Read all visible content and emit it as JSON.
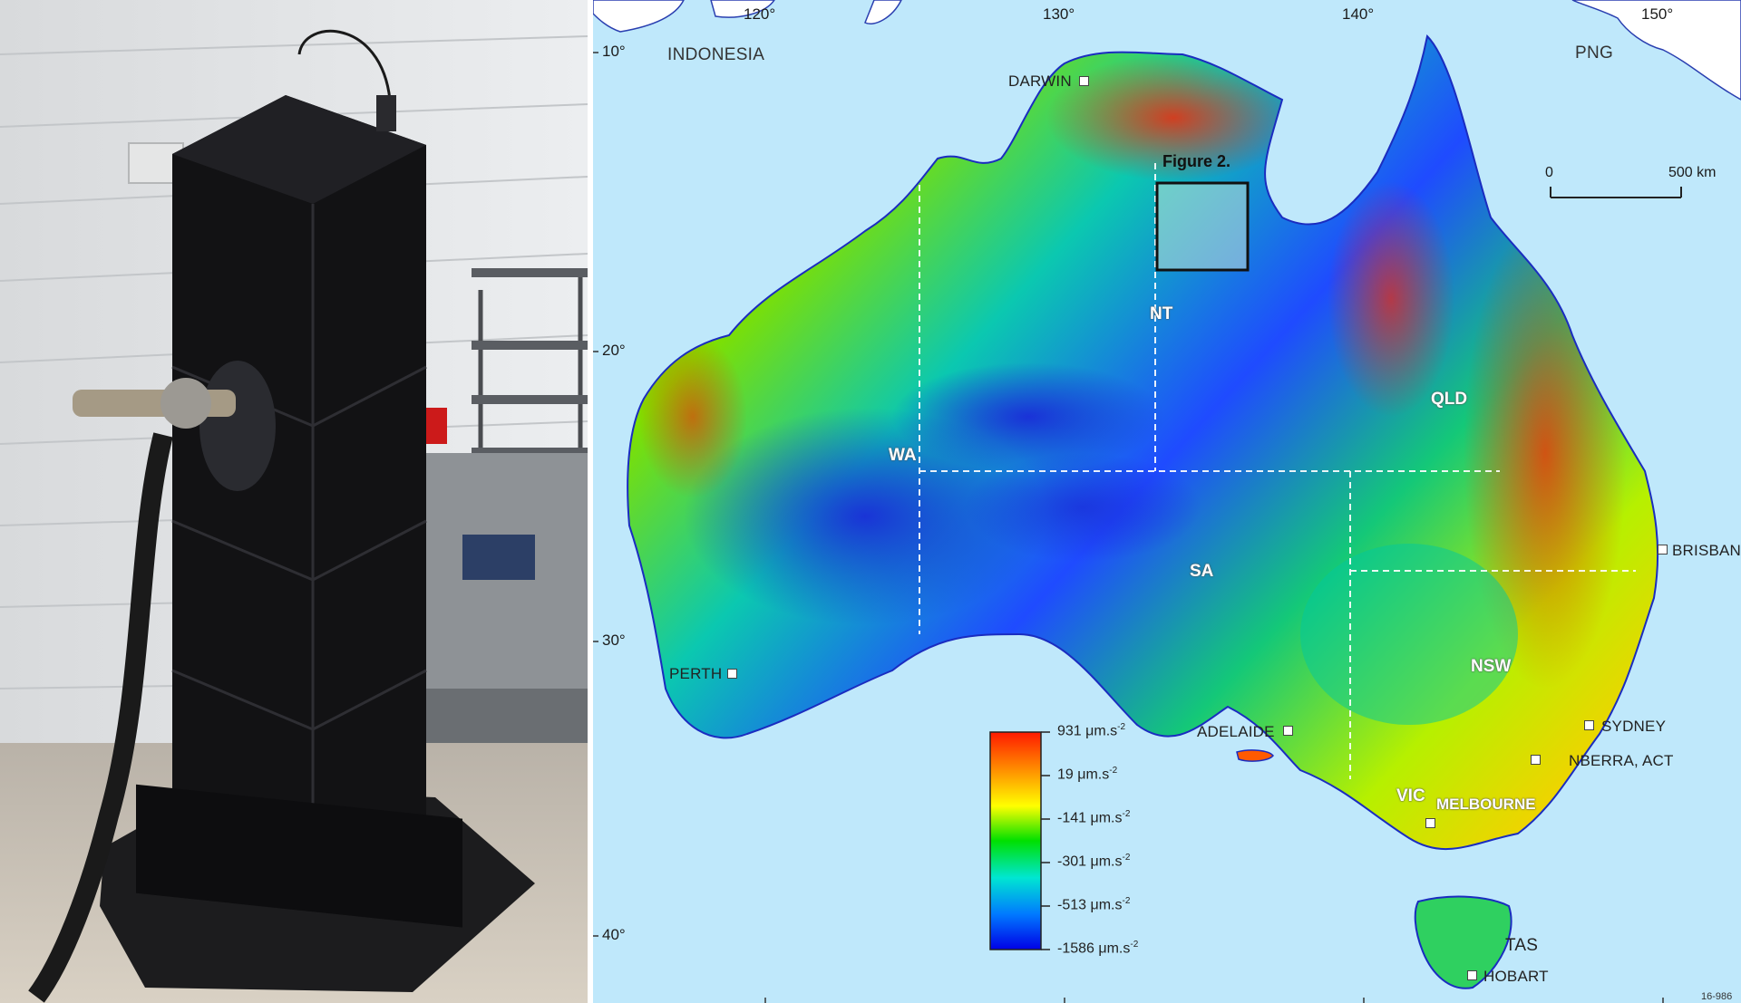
{
  "map": {
    "coords": {
      "lon_120": "120°",
      "lon_130": "130°",
      "lon_140": "140°",
      "lon_150": "150°",
      "lat_10": "10°",
      "lat_20": "20°",
      "lat_30": "30°",
      "lat_40": "40°"
    },
    "countries": {
      "indonesia": "INDONESIA",
      "png": "PNG"
    },
    "states": {
      "nt": "NT",
      "wa": "WA",
      "qld": "QLD",
      "sa": "SA",
      "nsw": "NSW",
      "vic": "VIC",
      "tas": "TAS"
    },
    "cities": {
      "darwin": "DARWIN",
      "perth": "PERTH",
      "adelaide": "ADELAIDE",
      "brisbane": "BRISBAN",
      "sydney": "SYDNEY",
      "canberra": "NBERRA, ACT",
      "melbourne": "MELBOURNE",
      "hobart": "HOBART"
    },
    "figure_box_label": "Figure 2.",
    "scale_bar": {
      "start": "0",
      "end": "500 km"
    },
    "legend": {
      "labels": [
        "931",
        "19",
        "-141",
        "-301",
        "-513",
        "-1586"
      ],
      "unit": "μm.s",
      "exponent": "-2",
      "colors": [
        "#ff1a00",
        "#ff8c00",
        "#ffff00",
        "#00e000",
        "#00e6d2",
        "#0078ff",
        "#0000e6"
      ]
    },
    "corner_code": "16-986"
  }
}
